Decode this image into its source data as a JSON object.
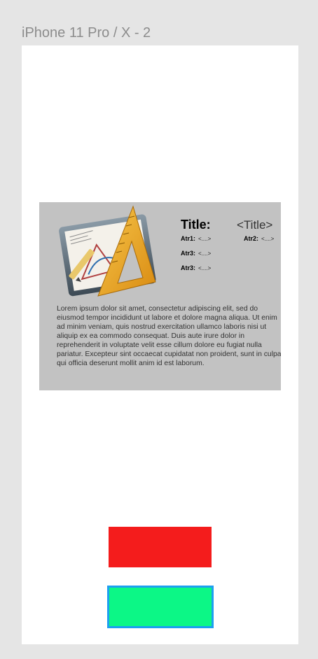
{
  "frame": {
    "label": "iPhone 11 Pro / X - 2"
  },
  "card": {
    "title_label": "Title:",
    "title_value": "<Title>",
    "attrs": [
      {
        "label": "Atr1:",
        "value": "<....>"
      },
      {
        "label": "Atr2:",
        "value": "<....>"
      },
      {
        "label": "Atr3:",
        "value": "<....>"
      },
      {
        "label": "Atr3:",
        "value": "<....>"
      }
    ],
    "description": "Lorem ipsum dolor sit amet, consectetur adipiscing elit, sed do eiusmod tempor incididunt ut labore et dolore magna aliqua. Ut enim ad minim veniam, quis nostrud exercitation ullamco laboris nisi ut aliquip ex ea commodo consequat. Duis aute irure dolor in reprehenderit in voluptate velit esse cillum dolore eu fugiat nulla pariatur. Excepteur sint occaecat cupidatat non proident, sunt in culpa qui officia deserunt mollit anim id est laborum.",
    "icon": "drawing-app-icon"
  },
  "colors": {
    "canvas_bg": "#e5e5e5",
    "artboard_bg": "#ffffff",
    "card_bg": "#c2c2c2",
    "red_button": "#f41c1c",
    "green_button": "#0cf786",
    "green_button_border": "#1d9ff0"
  }
}
